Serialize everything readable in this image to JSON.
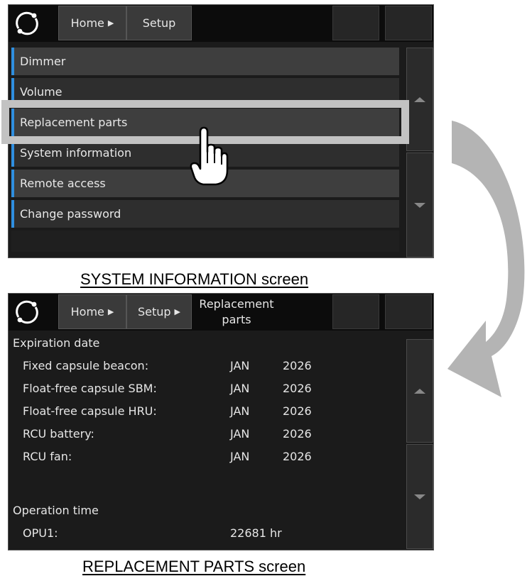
{
  "screen1": {
    "header": {
      "home_label": "Home",
      "setup_label": "Setup"
    },
    "menu_items": [
      {
        "label": "Dimmer"
      },
      {
        "label": "Volume"
      },
      {
        "label": "Replacement parts"
      },
      {
        "label": "System information"
      },
      {
        "label": "Remote access"
      },
      {
        "label": "Change password"
      }
    ],
    "caption": "SYSTEM INFORMATION screen"
  },
  "screen2": {
    "header": {
      "home_label": "Home",
      "setup_label": "Setup",
      "current_line1": "Replacement",
      "current_line2": "parts"
    },
    "expiration": {
      "heading": "Expiration date",
      "rows": [
        {
          "label": "Fixed capsule beacon:",
          "month": "JAN",
          "year": "2026"
        },
        {
          "label": "Float-free capsule SBM:",
          "month": "JAN",
          "year": "2026"
        },
        {
          "label": "Float-free capsule HRU:",
          "month": "JAN",
          "year": "2026"
        },
        {
          "label": "RCU battery:",
          "month": "JAN",
          "year": "2026"
        },
        {
          "label": "RCU fan:",
          "month": "JAN",
          "year": "2026"
        }
      ]
    },
    "operation": {
      "heading": "Operation time",
      "rows": [
        {
          "label": "OPU1:",
          "value": "22681 hr"
        }
      ]
    },
    "caption": "REPLACEMENT PARTS screen"
  },
  "colors": {
    "accent": "#2f8fe0",
    "highlight": "#c2c2c2",
    "arrow": "#b4b4b4",
    "screen_bg": "#1b1b1b"
  },
  "icons": [
    "refresh-logo-icon",
    "chevron-right-icon",
    "scroll-up-icon",
    "scroll-down-icon",
    "pointing-hand-icon",
    "curved-arrow-icon"
  ]
}
